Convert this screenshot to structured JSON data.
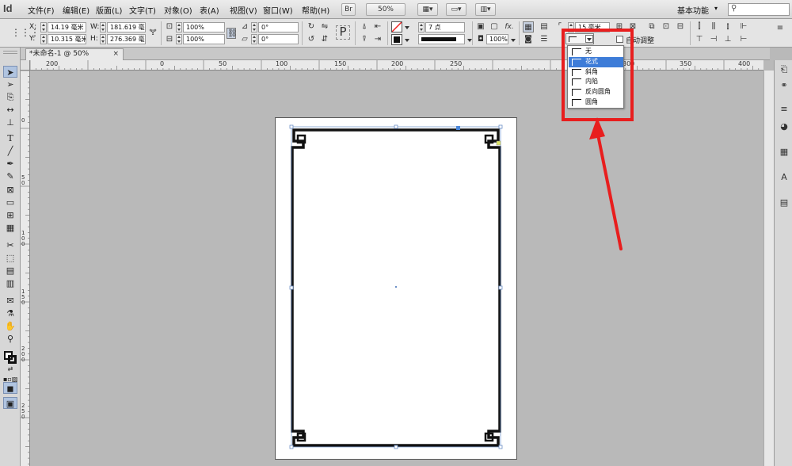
{
  "app": {
    "logo": "Id"
  },
  "menu": [
    "文件(F)",
    "编辑(E)",
    "版面(L)",
    "文字(T)",
    "对象(O)",
    "表(A)",
    "视图(V)",
    "窗口(W)",
    "帮助(H)"
  ],
  "menubar": {
    "bridge_label": "Br",
    "zoom_value": "50%",
    "workspace_label": "基本功能"
  },
  "control": {
    "x_label": "X:",
    "x_value": "14.19 毫米",
    "y_label": "Y:",
    "y_value": "10.315 毫米",
    "w_label": "W:",
    "w_value": "181.619 毫米",
    "h_label": "H:",
    "h_value": "276.369 毫米",
    "scale_x": "100%",
    "scale_y": "100%",
    "rotate": "0°",
    "shear": "0°",
    "stroke_weight": "7 点",
    "opacity": "100%",
    "corner_size": "15 毫米",
    "auto_fit_label": "自动调整"
  },
  "document": {
    "tab_title": "*未命名-1 @ 50%",
    "tab_close": "×"
  },
  "ruler": {
    "h_labels": [
      "200",
      "0",
      "50",
      "100",
      "150",
      "200",
      "250",
      "300",
      "350",
      "400"
    ],
    "v_labels": [
      "0",
      "50",
      "100",
      "150",
      "200",
      "250"
    ]
  },
  "corner_options": [
    {
      "label": "无",
      "selected": false
    },
    {
      "label": "花式",
      "selected": true
    },
    {
      "label": "斜角",
      "selected": false
    },
    {
      "label": "内陷",
      "selected": false
    },
    {
      "label": "反向圆角",
      "selected": false
    },
    {
      "label": "圆角",
      "selected": false
    }
  ],
  "colors": {
    "highlight": "#e81e1e",
    "selection": "#3d7cd8",
    "canvas": "#b9b9b9"
  },
  "icons": {
    "tools": [
      "selection-tool-icon",
      "direct-selection-tool-icon",
      "page-tool-icon",
      "gap-tool-icon",
      "content-collector-icon",
      "type-tool-icon",
      "line-tool-icon",
      "pen-tool-icon",
      "pencil-tool-icon",
      "rectangle-frame-tool-icon",
      "rectangle-tool-icon",
      "table-tool-icon",
      "grid-tool-icon",
      "scissors-tool-icon",
      "free-transform-tool-icon",
      "gradient-swatch-tool-icon",
      "gradient-feather-tool-icon",
      "note-tool-icon",
      "eyedropper-tool-icon",
      "hand-tool-icon",
      "zoom-tool-icon",
      "fill-stroke-icon",
      "swap-icon",
      "apply-color-icon",
      "view-mode-icon",
      "screen-mode-icon"
    ]
  }
}
